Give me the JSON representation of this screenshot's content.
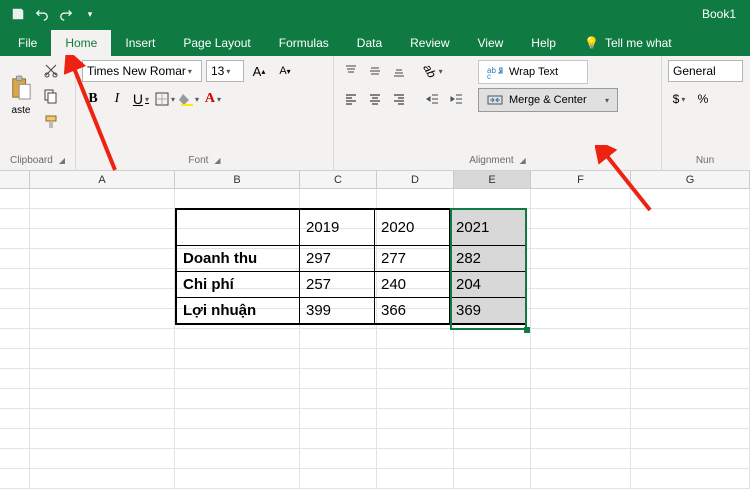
{
  "titlebar": {
    "book": "Book1"
  },
  "tabs": [
    "File",
    "Home",
    "Insert",
    "Page Layout",
    "Formulas",
    "Data",
    "Review",
    "View",
    "Help"
  ],
  "active_tab": "Home",
  "tellme": "Tell me what",
  "clipboard": {
    "paste": "aste",
    "label": "Clipboard"
  },
  "font": {
    "name": "Times New Romar",
    "size": "13",
    "label": "Font",
    "bold": "B",
    "italic": "I",
    "underline": "U"
  },
  "alignment": {
    "wrap": "Wrap Text",
    "merge": "Merge & Center",
    "label": "Alignment"
  },
  "number": {
    "format": "General",
    "label": "Nun"
  },
  "columns": [
    "A",
    "B",
    "C",
    "D",
    "E",
    "F",
    "G"
  ],
  "chart_data": {
    "type": "table",
    "col_headers": [
      "2019",
      "2020",
      "2021"
    ],
    "row_headers": [
      "Doanh thu",
      "Chi phí",
      "Lợi nhuận"
    ],
    "rows": [
      [
        "297",
        "277",
        "282"
      ],
      [
        "257",
        "240",
        "204"
      ],
      [
        "399",
        "366",
        "369"
      ]
    ]
  }
}
